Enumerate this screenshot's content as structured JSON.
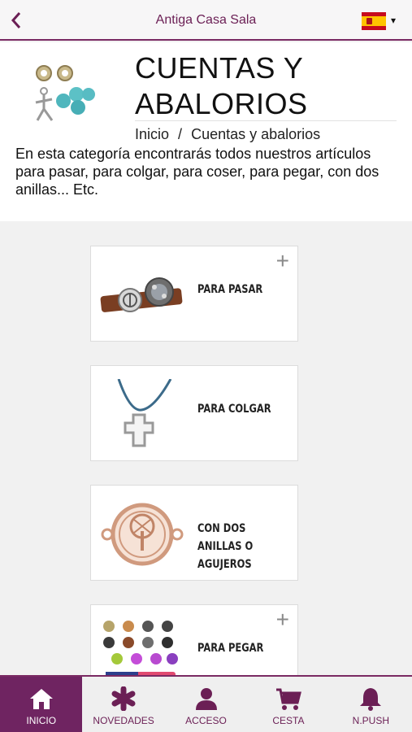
{
  "app": {
    "title": "Antiga Casa Sala"
  },
  "header": {
    "title_line1": "CUENTAS Y",
    "title_line2": "ABALORIOS",
    "breadcrumb": [
      "Inicio",
      "Cuentas y abalorios"
    ],
    "breadcrumb_sep": "/",
    "description": "En esta categoría encontrarás todos nuestros artículos para pasar, para colgar, para coser, para pegar, con dos anillas... Etc."
  },
  "language": {
    "icon": "spain-flag-icon",
    "caret": "▾"
  },
  "categories": [
    {
      "label": "PARA PASAR",
      "expandable": "+"
    },
    {
      "label": "PARA COLGAR"
    },
    {
      "label": "CON DOS ANILLAS O AGUJEROS"
    },
    {
      "label": "PARA PEGAR",
      "expandable": "+"
    }
  ],
  "tabs": [
    {
      "label": "INICIO",
      "icon": "home-icon",
      "active": true
    },
    {
      "label": "NOVEDADES",
      "icon": "asterisk-icon"
    },
    {
      "label": "ACCESO",
      "icon": "user-icon"
    },
    {
      "label": "CESTA",
      "icon": "cart-icon"
    },
    {
      "label": "N.PUSH",
      "icon": "bell-icon"
    }
  ],
  "colors": {
    "accent": "#6f2461",
    "background": "#f1f1f1"
  }
}
